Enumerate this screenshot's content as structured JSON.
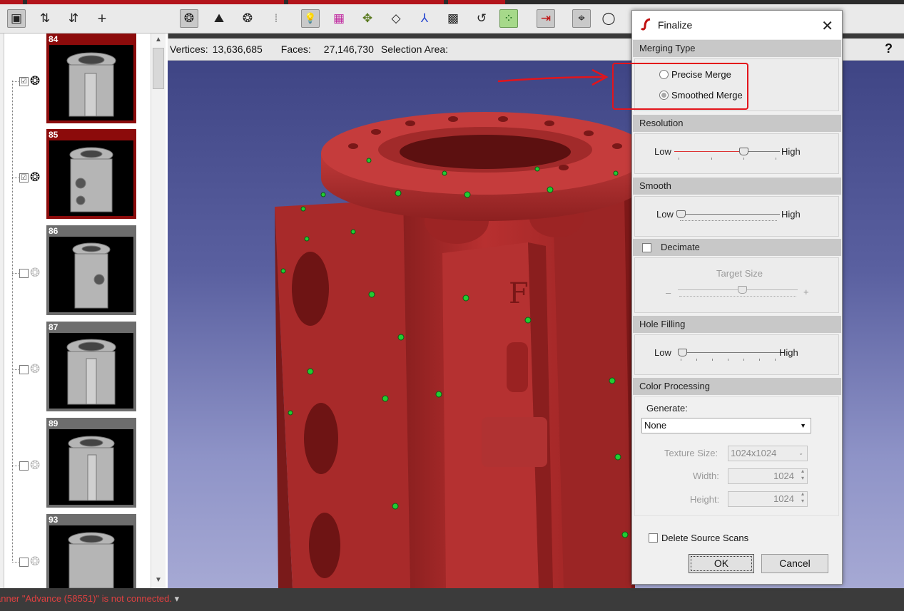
{
  "toolbar": {
    "buttons": [
      {
        "name": "image-icon",
        "glyph": "▣"
      },
      {
        "name": "sort-asc-icon",
        "glyph": "⇅"
      },
      {
        "name": "sort-desc-icon",
        "glyph": "⇵"
      },
      {
        "name": "add-icon",
        "glyph": "+"
      },
      {
        "name": "wheel-icon",
        "glyph": "❂"
      },
      {
        "name": "texture-icon",
        "glyph": "⛰"
      },
      {
        "name": "wireframe-icon",
        "glyph": "❂"
      },
      {
        "name": "points-icon",
        "glyph": "⁞"
      },
      {
        "name": "light-icon",
        "glyph": "💡"
      },
      {
        "name": "color-grid-icon",
        "glyph": "▦"
      },
      {
        "name": "align-icon",
        "glyph": "✥"
      },
      {
        "name": "cube-icon",
        "glyph": "◇"
      },
      {
        "name": "axes-icon",
        "glyph": "⅄"
      },
      {
        "name": "checker-icon",
        "glyph": "▩"
      },
      {
        "name": "rotate-icon",
        "glyph": "↺"
      },
      {
        "name": "markers-icon",
        "glyph": "⁘"
      },
      {
        "name": "pointer-icon",
        "glyph": "⇥"
      },
      {
        "name": "lasso-icon",
        "glyph": "⌖"
      },
      {
        "name": "circle-select-icon",
        "glyph": "◯"
      }
    ]
  },
  "scan_list": {
    "items": [
      {
        "number": "84",
        "selected": true,
        "checked": "☑"
      },
      {
        "number": "85",
        "selected": true,
        "checked": "☑"
      },
      {
        "number": "86",
        "selected": false,
        "checked": ""
      },
      {
        "number": "87",
        "selected": false,
        "checked": ""
      },
      {
        "number": "89",
        "selected": false,
        "checked": ""
      },
      {
        "number": "93",
        "selected": false,
        "checked": ""
      }
    ]
  },
  "info_bar": {
    "vertices_label": "Vertices:",
    "vertices_value": "13,636,685",
    "faces_label": "Faces:",
    "faces_value": "27,146,730",
    "selection_label": "Selection Area:",
    "help": "?"
  },
  "status": {
    "message": "anner \"Advance (58551)\" is not connected.",
    "arrow": "▾"
  },
  "dialog": {
    "title": "Finalize",
    "close": "✕",
    "merging": {
      "heading": "Merging Type",
      "precise": "Precise Merge",
      "smoothed": "Smoothed Merge",
      "selected": "Smoothed Merge"
    },
    "resolution": {
      "heading": "Resolution",
      "low": "Low",
      "high": "High",
      "value": 0.68
    },
    "smooth": {
      "heading": "Smooth",
      "low": "Low",
      "high": "High",
      "value": 0.0
    },
    "decimate": {
      "heading": "Decimate",
      "checked": false,
      "target_label": "Target Size",
      "minus": "–",
      "plus": "+",
      "value": 0.5
    },
    "hole_filling": {
      "heading": "Hole Filling",
      "low": "Low",
      "high": "High",
      "value": 0.0
    },
    "color": {
      "heading": "Color Processing",
      "generate_label": "Generate:",
      "generate_value": "None",
      "texture_label": "Texture Size:",
      "texture_value": "1024x1024",
      "width_label": "Width:",
      "width_value": "1024",
      "height_label": "Height:",
      "height_value": "1024"
    },
    "delete_source": "Delete Source Scans",
    "ok": "OK",
    "cancel": "Cancel"
  },
  "model": {
    "embossed_letter": "F"
  },
  "colors": {
    "accent_red": "#b3141b",
    "annotation": "#e3141b",
    "model": "#b32a2a",
    "viewport_top": "#3f4585"
  }
}
